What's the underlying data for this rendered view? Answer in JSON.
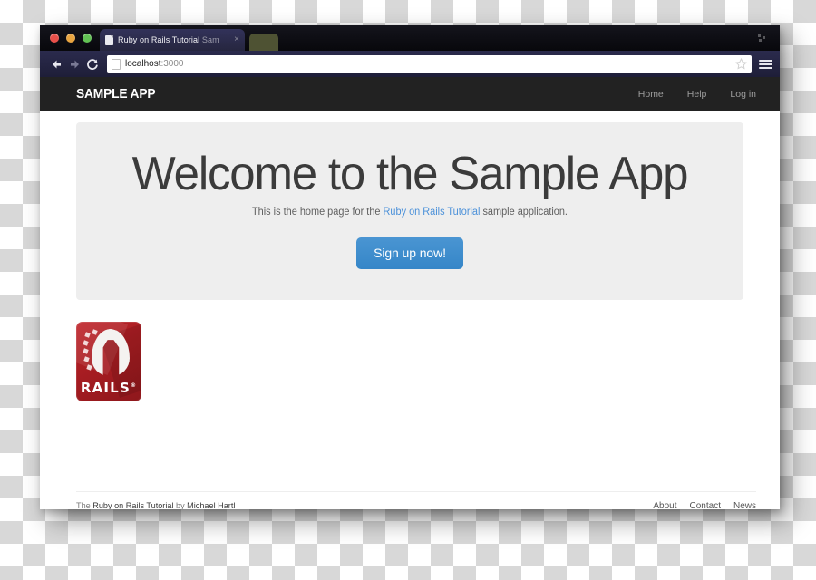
{
  "browser": {
    "tab": {
      "title_main": "Ruby on Rails Tutorial",
      "title_dim": "Sam",
      "close_glyph": "×"
    },
    "toolbar": {
      "url_host": "localhost",
      "url_port": ":3000",
      "back_label": "Back",
      "forward_label": "Forward",
      "reload_label": "C"
    }
  },
  "navbar": {
    "logo": "SAMPLE APP",
    "links": [
      {
        "label": "Home"
      },
      {
        "label": "Help"
      },
      {
        "label": "Log in"
      }
    ]
  },
  "hero": {
    "heading": "Welcome to the Sample App",
    "subtitle_before": "This is the home page for the ",
    "subtitle_link": "Ruby on Rails Tutorial",
    "subtitle_after": " sample application.",
    "cta_label": "Sign up now!"
  },
  "logo": {
    "wordmark": "RAILS",
    "trademark": "®"
  },
  "footer": {
    "credit_before": "The ",
    "credit_link": "Ruby on Rails Tutorial",
    "credit_mid": " by ",
    "credit_author": "Michael Hartl",
    "links": [
      {
        "label": "About"
      },
      {
        "label": "Contact"
      },
      {
        "label": "News"
      }
    ]
  },
  "colors": {
    "navbar_bg": "#222222",
    "jumbotron_bg": "#eeeeee",
    "link_blue": "#4a90d9",
    "button_blue": "#3c8dce",
    "rails_red": "#b01f24"
  }
}
